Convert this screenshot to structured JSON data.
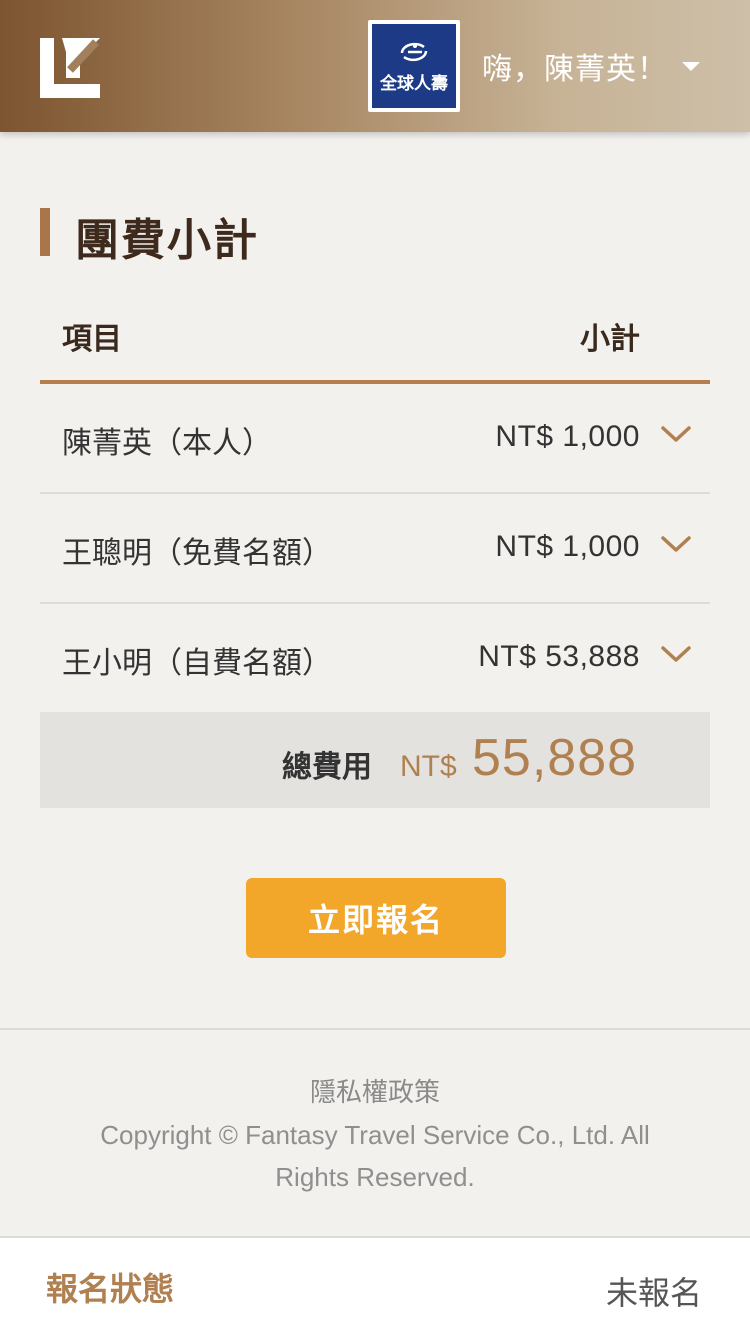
{
  "header": {
    "brand_text": "全球人壽",
    "greeting": "嗨，陳菁英！"
  },
  "section": {
    "title": "團費小計"
  },
  "table": {
    "col_item": "項目",
    "col_subtotal": "小計",
    "rows": [
      {
        "name": "陳菁英（本人）",
        "amount": "NT$ 1,000"
      },
      {
        "name": "王聰明（免費名額）",
        "amount": "NT$ 1,000"
      },
      {
        "name": "王小明（自費名額）",
        "amount": "NT$ 53,888"
      }
    ]
  },
  "total": {
    "label": "總費用",
    "currency": "NT$",
    "value": "55,888"
  },
  "actions": {
    "register_label": "立即報名"
  },
  "footer": {
    "privacy": "隱私權政策",
    "copyright": "Copyright © Fantasy Travel Service Co., Ltd. All Rights Reserved."
  },
  "status": {
    "label": "報名狀態",
    "value": "未報名"
  },
  "colors": {
    "accent": "#b08050",
    "button": "#f2a72b",
    "brand_blue": "#1d3a86"
  }
}
